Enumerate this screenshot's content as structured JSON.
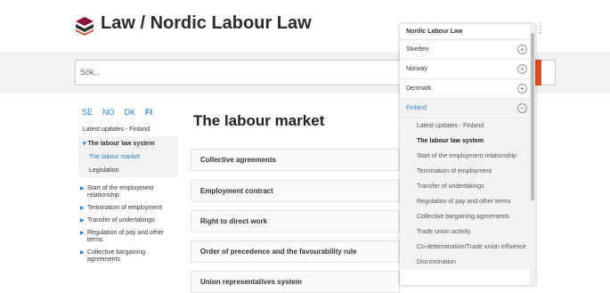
{
  "header": {
    "title": "Law / Nordic Labour Law"
  },
  "search": {
    "placeholder": "Sök..."
  },
  "lang_tabs": [
    "SE",
    "NO",
    "DK",
    "FI"
  ],
  "sidenav": {
    "latest": "Latest updates - Finland",
    "group": "The labour law system",
    "sub_items": [
      "The labour market",
      "Legislation"
    ],
    "items": [
      "Start of the employment relationship",
      "Termination of employment",
      "Transfer of undertakings",
      "Regulation of pay and other terms",
      "Collective bargaining agreements"
    ]
  },
  "main": {
    "title": "The labour market",
    "sections": [
      "Collective agreements",
      "Employment contract",
      "Right to direct work",
      "Order of precedence and the favourability rule",
      "Union representatives system"
    ]
  },
  "dropdown": {
    "title": "Nordic Labour Law",
    "countries": [
      "Sweden",
      "Norway",
      "Denmark",
      "Finland"
    ],
    "finland_items": [
      "Latest updates - Finland",
      "The labour law system",
      "Start of the employment relationship",
      "Termination of employment",
      "Transfer of undertakings",
      "Regulation of pay and other terms",
      "Collective bargaining agreements",
      "Trade union activity",
      "Co-determination/Trade union influence",
      "Discrimination"
    ]
  },
  "colors": {
    "accent": "#2a7fc4",
    "brand": "#d94f2b"
  }
}
